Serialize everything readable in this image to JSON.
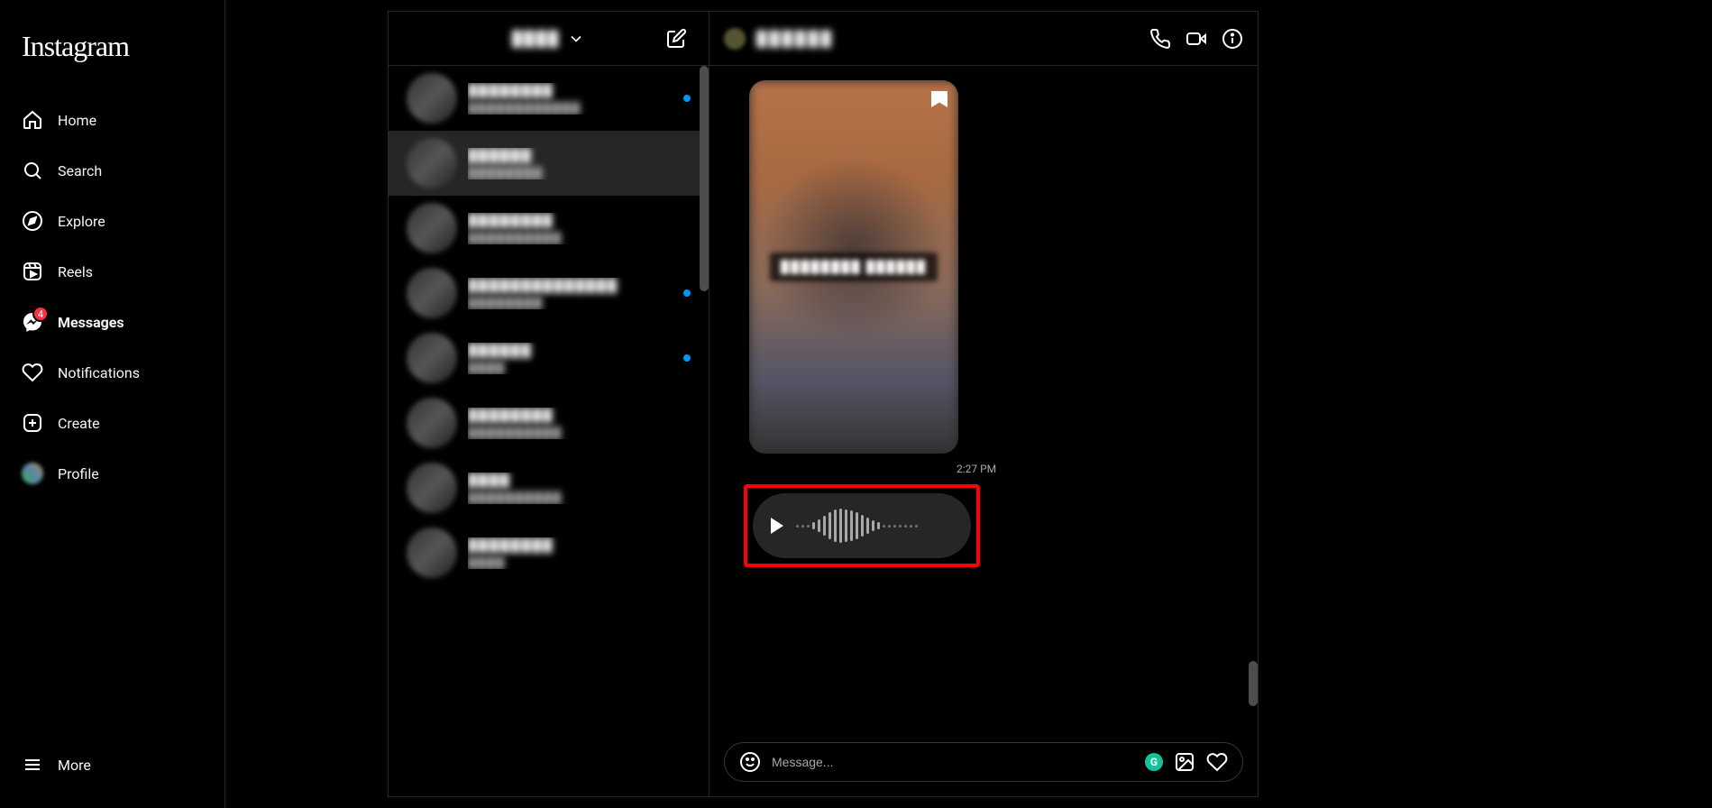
{
  "app": {
    "name": "Instagram"
  },
  "sidebar": {
    "home": "Home",
    "search": "Search",
    "explore": "Explore",
    "reels": "Reels",
    "messages": "Messages",
    "messages_badge": "4",
    "notifications": "Notifications",
    "create": "Create",
    "profile": "Profile",
    "more": "More"
  },
  "inbox": {
    "account": "████",
    "threads": [
      {
        "name": "████████",
        "sub": "████████████",
        "unread": true
      },
      {
        "name": "██████",
        "sub": "████████",
        "unread": false,
        "selected": true
      },
      {
        "name": "████████",
        "sub": "██████████",
        "unread": false
      },
      {
        "name": "██████████████",
        "sub": "████████",
        "unread": true
      },
      {
        "name": "██████",
        "sub": "████",
        "unread": true
      },
      {
        "name": "████████",
        "sub": "██████████",
        "unread": false
      },
      {
        "name": "████",
        "sub": "██████████",
        "unread": false
      },
      {
        "name": "████████",
        "sub": "████",
        "unread": false
      }
    ]
  },
  "chat": {
    "title": "██████",
    "shared_caption": "████████\n██████",
    "timestamp": "2:27 PM",
    "composer_placeholder": "Message..."
  }
}
